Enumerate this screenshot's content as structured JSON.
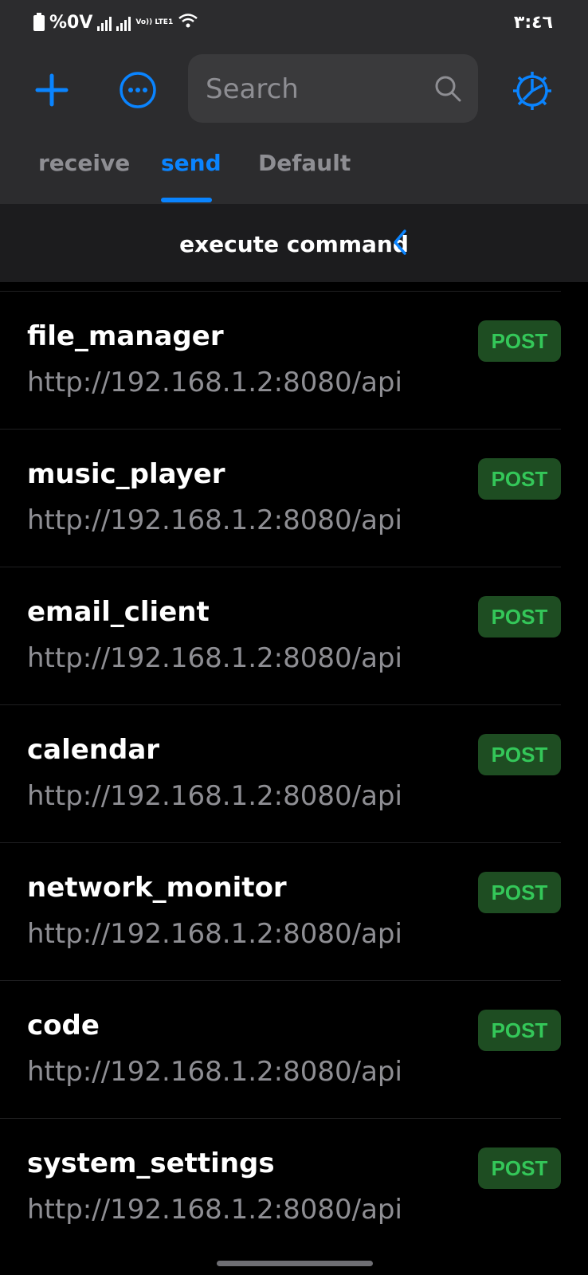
{
  "status_bar": {
    "battery": "%0V",
    "network": "Vo)) LTE1",
    "time": "٣:٤٦"
  },
  "toolbar": {
    "search_placeholder": "Search",
    "icons": [
      "plus-icon",
      "more-icon",
      "search-icon",
      "gear-icon"
    ],
    "accent_color": "#0a84ff"
  },
  "tabs": [
    {
      "label": "receive",
      "active": false
    },
    {
      "label": "send",
      "active": true
    },
    {
      "label": "Default",
      "active": false
    }
  ],
  "subheader": {
    "title": "execute command"
  },
  "items": [
    {
      "name": "file_manager",
      "url": "http://192.168.1.2:8080/api",
      "method": "POST"
    },
    {
      "name": "music_player",
      "url": "http://192.168.1.2:8080/api",
      "method": "POST"
    },
    {
      "name": "email_client",
      "url": "http://192.168.1.2:8080/api",
      "method": "POST"
    },
    {
      "name": "calendar",
      "url": "http://192.168.1.2:8080/api",
      "method": "POST"
    },
    {
      "name": "network_monitor",
      "url": "http://192.168.1.2:8080/api",
      "method": "POST"
    },
    {
      "name": "code",
      "url": "http://192.168.1.2:8080/api",
      "method": "POST"
    },
    {
      "name": "system_settings",
      "url": "http://192.168.1.2:8080/api",
      "method": "POST"
    }
  ]
}
